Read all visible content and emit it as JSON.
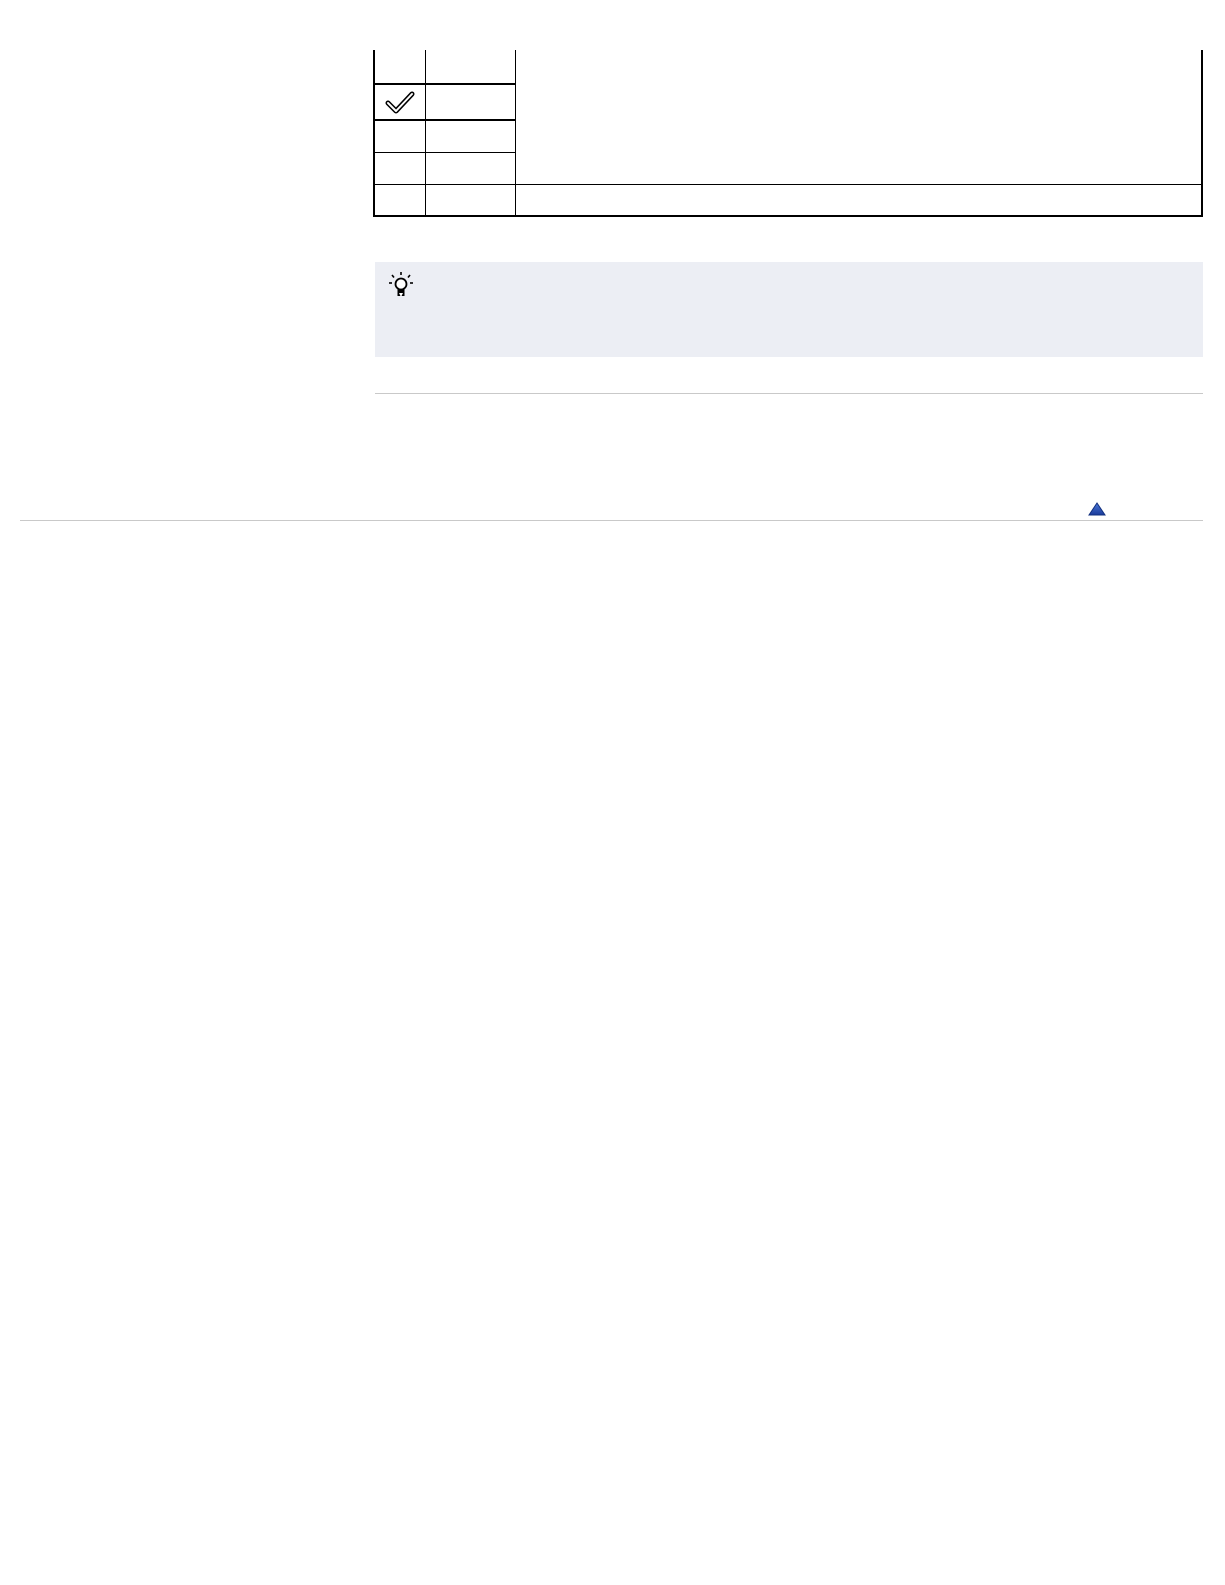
{
  "settings_table": {
    "rows": [
      {
        "selected": false,
        "icon": "",
        "value": ""
      },
      {
        "selected": true,
        "icon": "checkmark-icon",
        "value": ""
      },
      {
        "selected": false,
        "icon": "",
        "value": ""
      },
      {
        "selected": false,
        "icon": "",
        "value": ""
      },
      {
        "selected": false,
        "icon": "",
        "value": ""
      }
    ]
  },
  "tip": {
    "icon": "lightbulb-hint-icon",
    "background": "#ECEEF4"
  },
  "navigation": {
    "page_top_icon": "up-triangle-icon",
    "accent_color": "#1A3A9A"
  }
}
